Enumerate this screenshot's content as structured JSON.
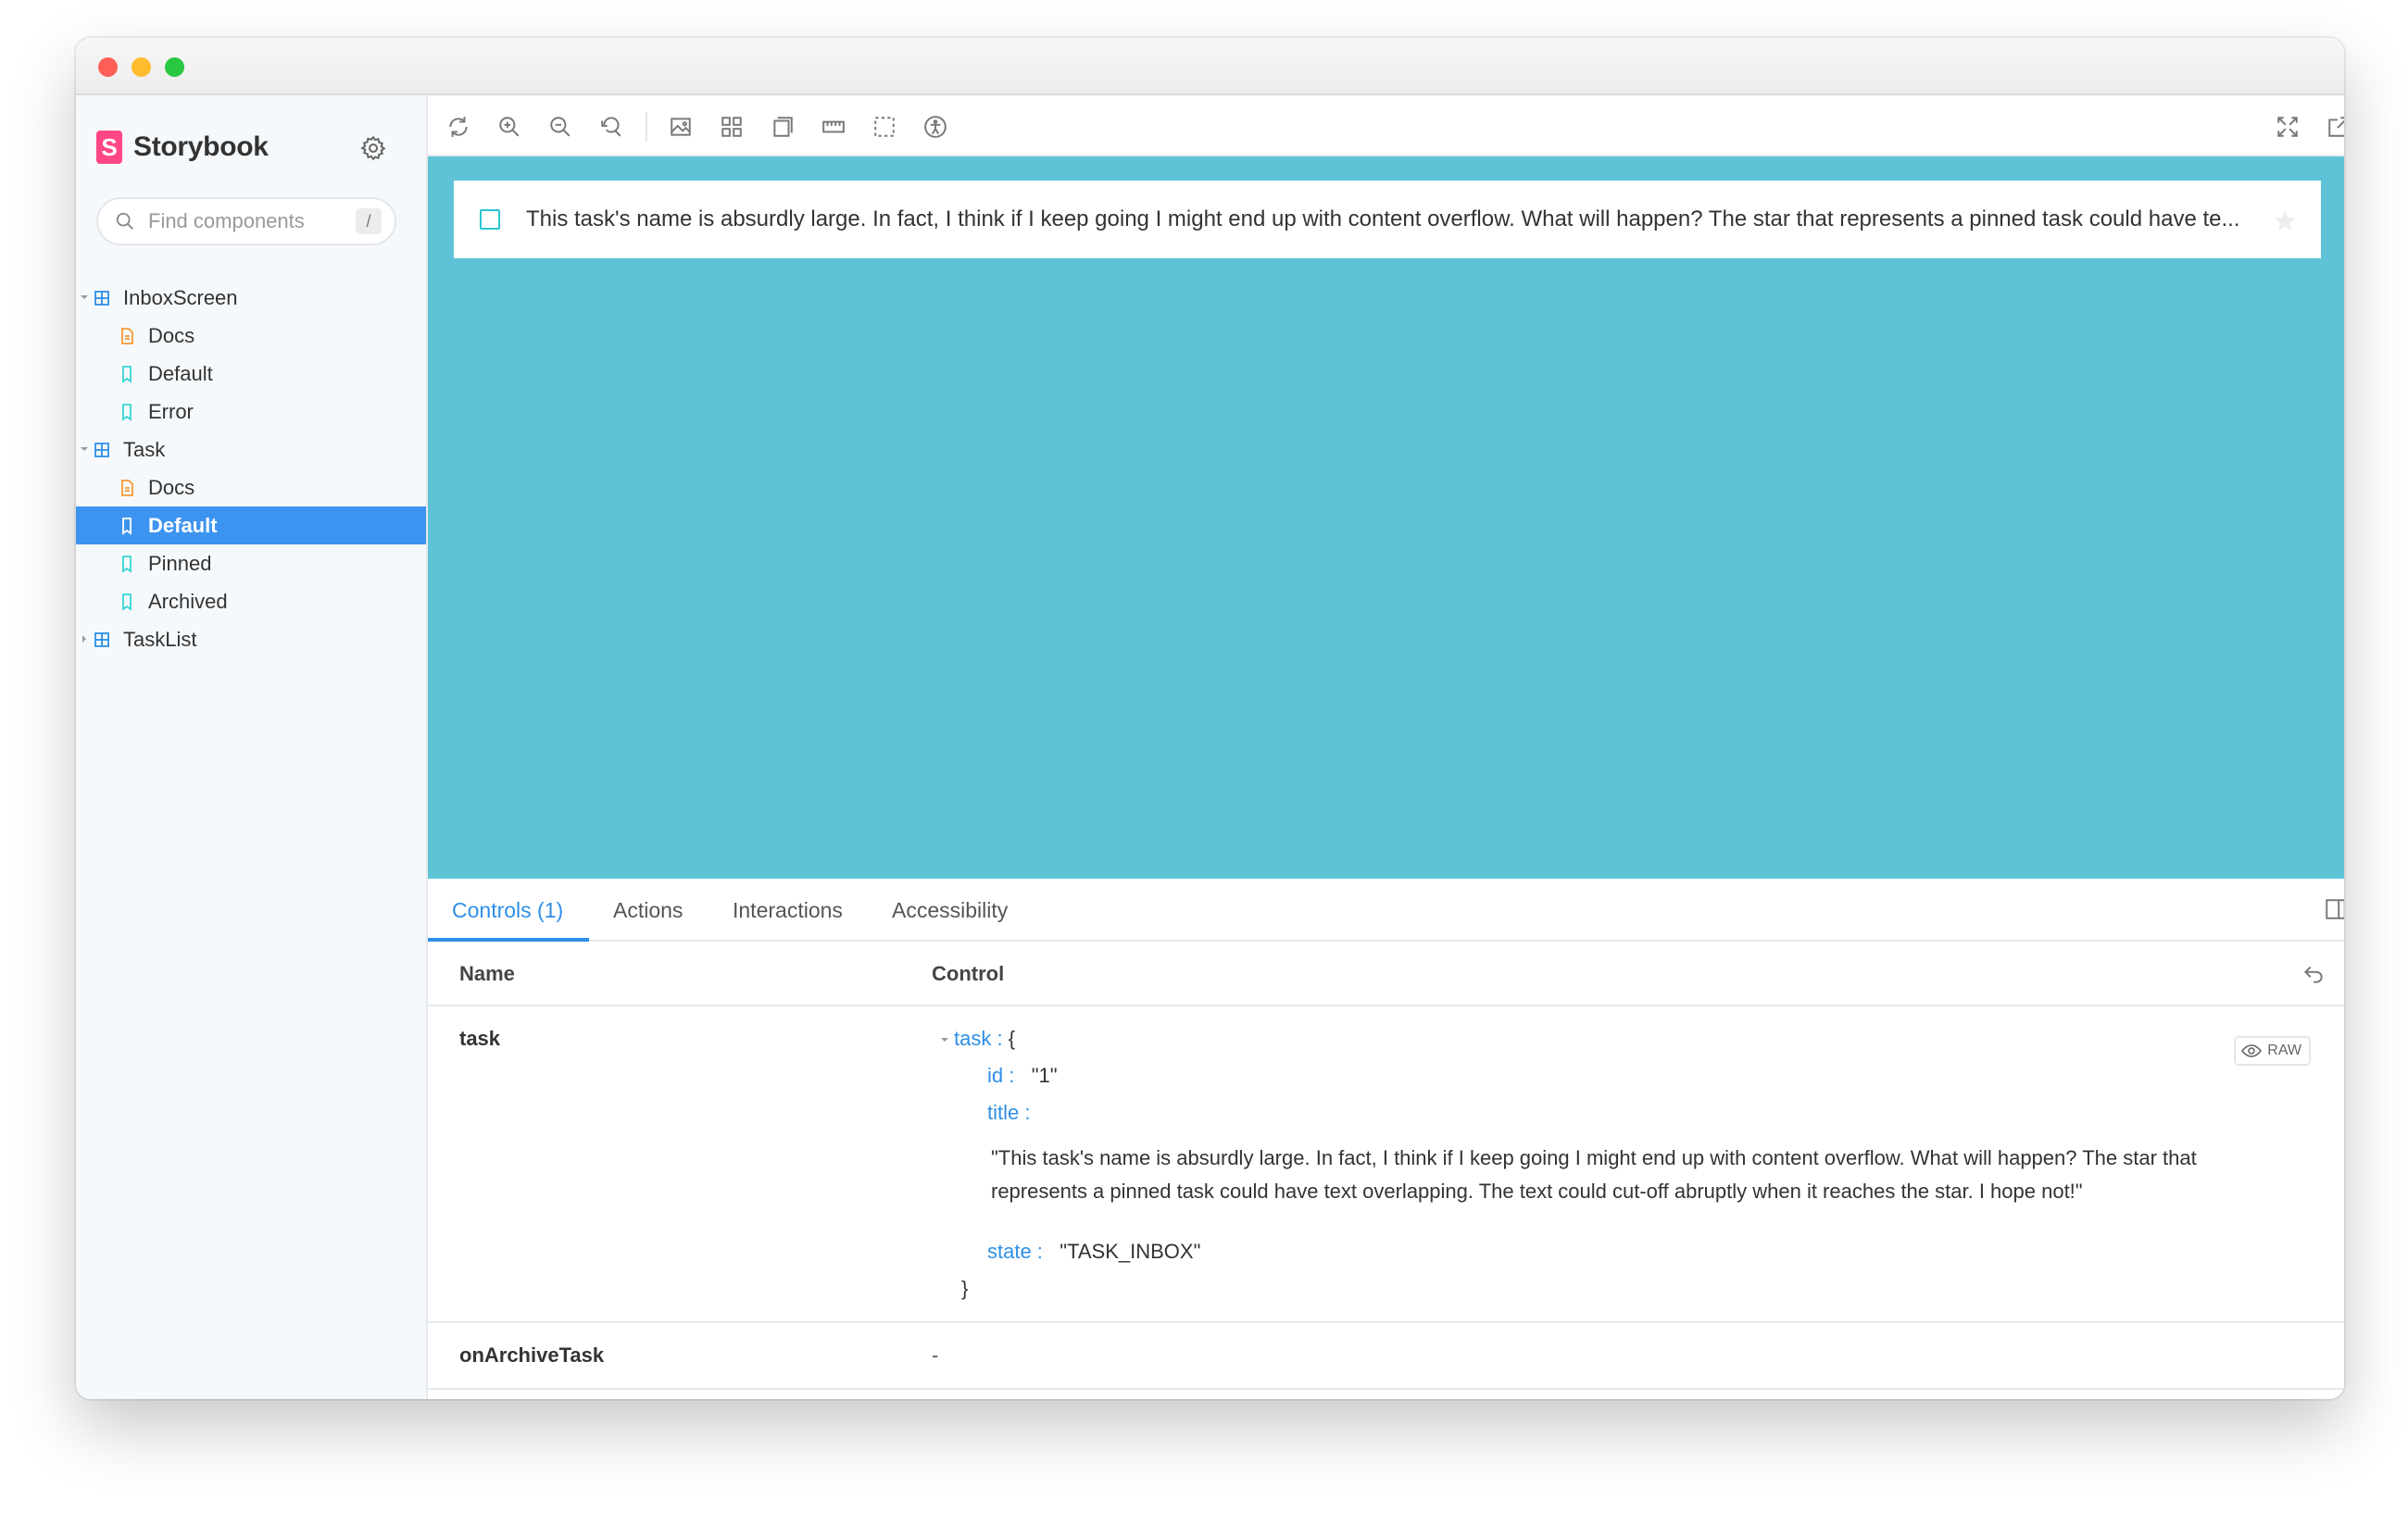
{
  "app": {
    "brand": "Storybook",
    "brand_logo_letter": "S"
  },
  "sidebar": {
    "search_placeholder": "Find components",
    "search_shortcut": "/",
    "tree": [
      {
        "label": "InboxScreen",
        "type": "group",
        "expanded": true
      },
      {
        "label": "Docs",
        "type": "docs"
      },
      {
        "label": "Default",
        "type": "story"
      },
      {
        "label": "Error",
        "type": "story"
      },
      {
        "label": "Task",
        "type": "group",
        "expanded": true
      },
      {
        "label": "Docs",
        "type": "docs"
      },
      {
        "label": "Default",
        "type": "story",
        "selected": true
      },
      {
        "label": "Pinned",
        "type": "story"
      },
      {
        "label": "Archived",
        "type": "story"
      },
      {
        "label": "TaskList",
        "type": "group",
        "expanded": false
      }
    ]
  },
  "toolbar": {
    "left_icons": [
      "reload-icon",
      "zoom-in-icon",
      "zoom-out-icon",
      "zoom-reset-icon",
      "background-icon",
      "grid-icon",
      "viewport-icon",
      "measure-icon",
      "outline-icon",
      "accessibility-icon"
    ],
    "right_icons": [
      "fullscreen-icon",
      "open-new-tab-icon",
      "copy-link-icon"
    ]
  },
  "canvas": {
    "background": "#5ec3d6",
    "task_title": "This task's name is absurdly large. In fact, I think if I keep going I might end up with content overflow. What will happen? The star that represents a pinned task could have te..."
  },
  "panel": {
    "tabs": [
      "Controls (1)",
      "Actions",
      "Interactions",
      "Accessibility"
    ],
    "active_tab": "Controls (1)",
    "col_name": "Name",
    "col_control": "Control",
    "rows": {
      "task": {
        "name": "task",
        "obj_key": "task :",
        "obj_open": "{",
        "id_key": "id :",
        "id_value": "\"1\"",
        "title_key": "title :",
        "title_value": "\"This task's name is absurdly large. In fact, I think if I keep going I might end up with content overflow. What will happen? The star that represents a pinned task could have text overlapping. The text could cut-off abruptly when it reaches the star. I hope not!\"",
        "state_key": "state :",
        "state_value": "\"TASK_INBOX\"",
        "obj_close": "}",
        "raw_label": "RAW"
      },
      "archive": {
        "name": "onArchiveTask",
        "value": "-"
      }
    }
  },
  "colors": {
    "accent": "#2f8fe6",
    "selected_bg": "#3d94f0",
    "brand_pink": "#ff4785",
    "canvas_bg": "#5ec3d6",
    "checkbox": "#2cc5d2"
  }
}
